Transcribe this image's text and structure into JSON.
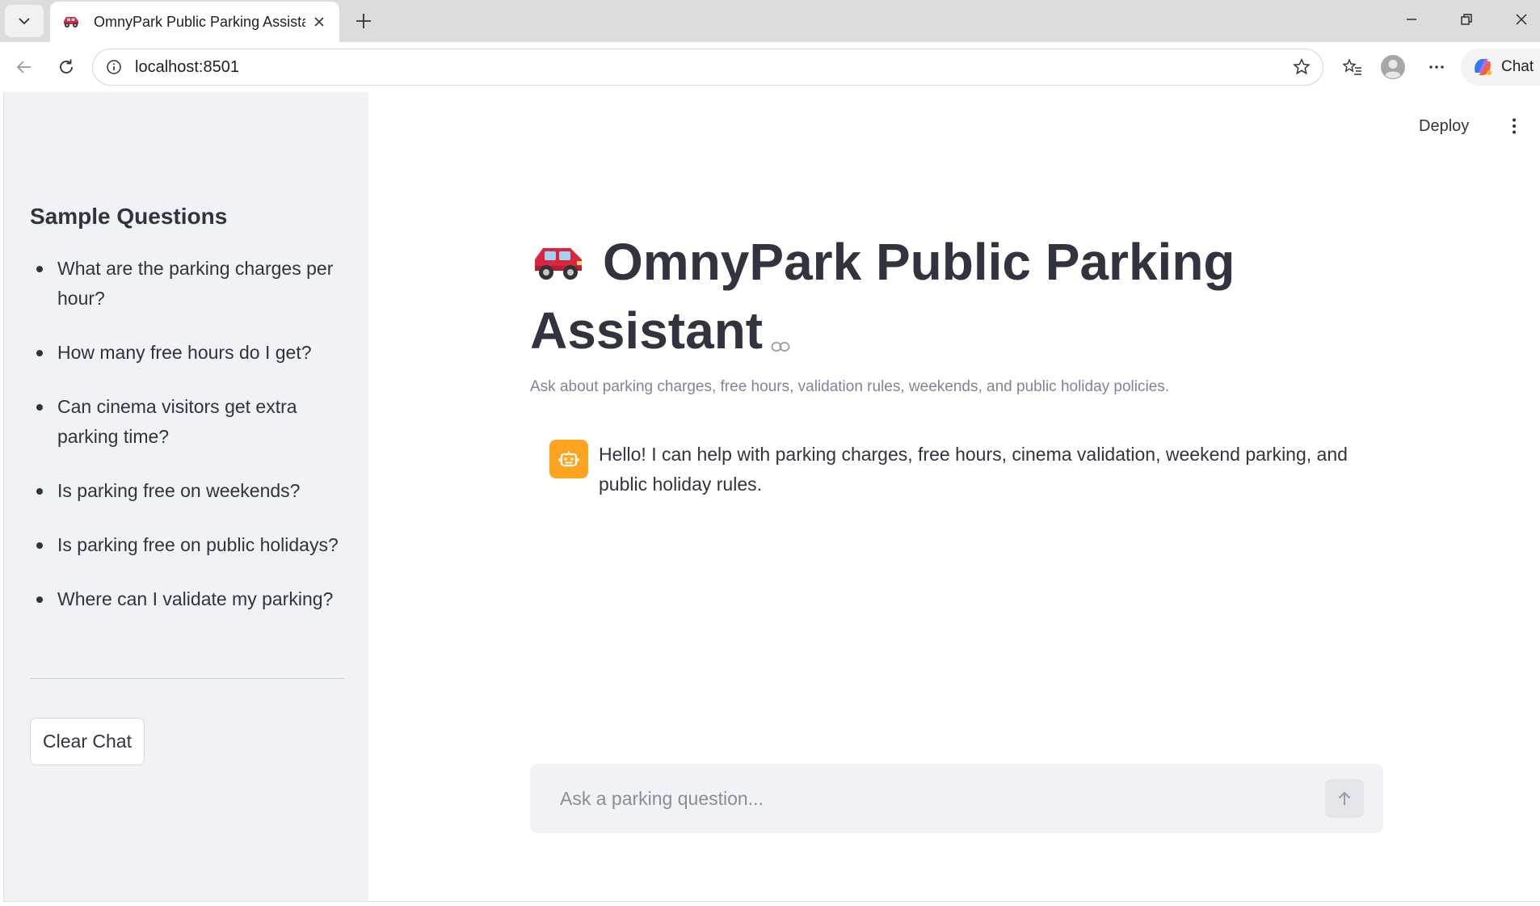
{
  "browser": {
    "tab_title": "OmnyPark Public Parking Assistant",
    "url": "localhost:8501",
    "chat_label": "Chat"
  },
  "sidebar": {
    "heading": "Sample Questions",
    "questions": [
      "What are the parking charges per hour?",
      "How many free hours do I get?",
      "Can cinema visitors get extra parking time?",
      "Is parking free on weekends?",
      "Is parking free on public holidays?",
      "Where can I validate my parking?"
    ],
    "clear_label": "Clear Chat"
  },
  "header": {
    "deploy_label": "Deploy"
  },
  "main": {
    "title": "OmnyPark Public Parking Assistant",
    "subtitle": "Ask about parking charges, free hours, validation rules, weekends, and public holiday policies.",
    "assistant_message": "Hello! I can help with parking charges, free hours, cinema validation, weekend parking, and public holiday rules.",
    "input_placeholder": "Ask a parking question..."
  },
  "icons": {
    "tab_favicon": "car-icon",
    "title_emoji": "car-icon",
    "avatar": "robot-icon"
  },
  "colors": {
    "accent_avatar": "#ffa421",
    "sidebar_bg": "#f0f2f6",
    "text": "#31333f"
  }
}
